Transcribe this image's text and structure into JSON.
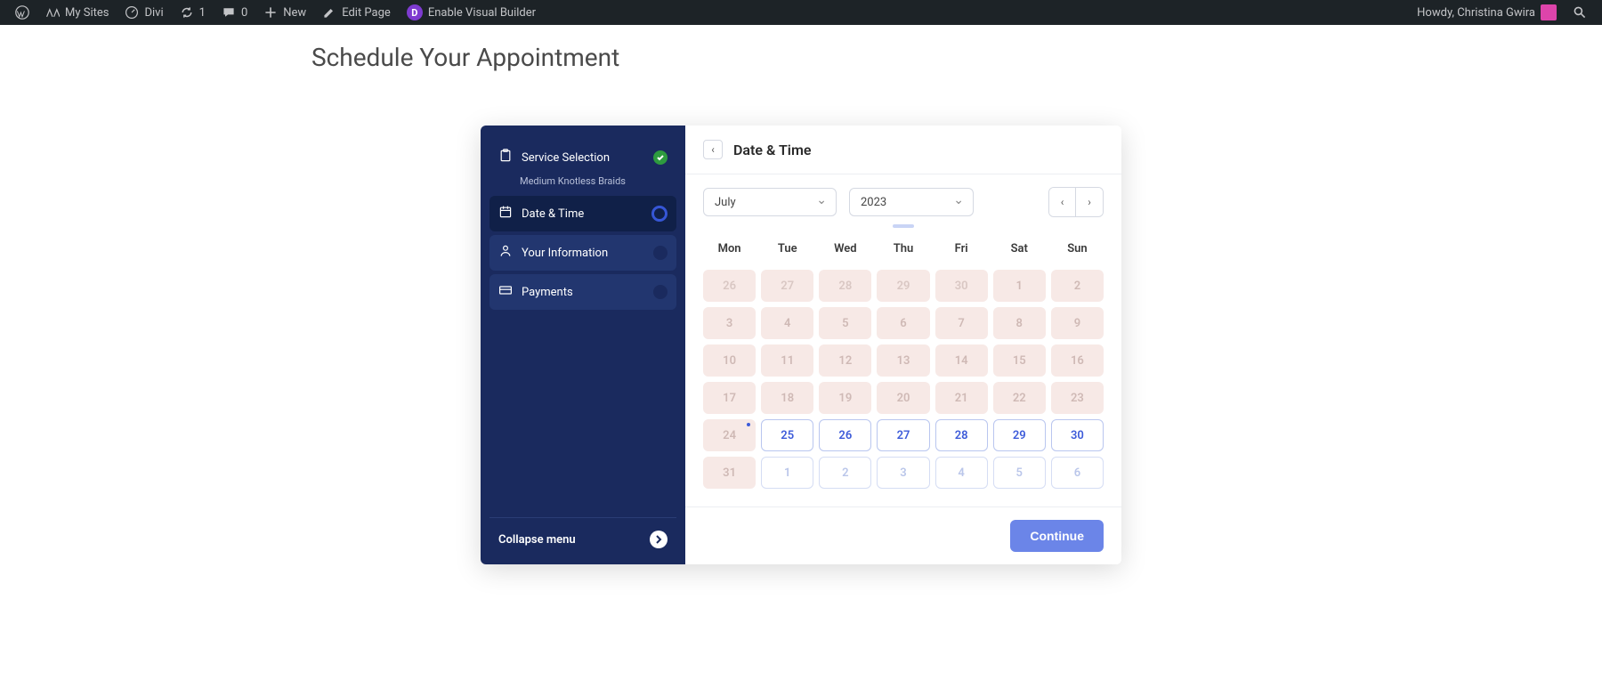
{
  "adminbar": {
    "mysites": "My Sites",
    "divi": "Divi",
    "updates": "1",
    "comments": "0",
    "new": "New",
    "edit_page": "Edit Page",
    "visual_builder": "Enable Visual Builder",
    "howdy": "Howdy, Christina Gwira"
  },
  "page": {
    "title": "Schedule Your Appointment"
  },
  "sidebar": {
    "steps": [
      {
        "label": "Service Selection",
        "sub": "Medium Knotless Braids"
      },
      {
        "label": "Date & Time"
      },
      {
        "label": "Your Information"
      },
      {
        "label": "Payments"
      }
    ],
    "collapse": "Collapse menu"
  },
  "main": {
    "title": "Date & Time",
    "month": "July",
    "year": "2023",
    "weekdays": [
      "Mon",
      "Tue",
      "Wed",
      "Thu",
      "Fri",
      "Sat",
      "Sun"
    ],
    "days": [
      {
        "n": "26",
        "state": "disabled",
        "other": true
      },
      {
        "n": "27",
        "state": "disabled",
        "other": true
      },
      {
        "n": "28",
        "state": "disabled",
        "other": true
      },
      {
        "n": "29",
        "state": "disabled",
        "other": true
      },
      {
        "n": "30",
        "state": "disabled",
        "other": true
      },
      {
        "n": "1",
        "state": "disabled"
      },
      {
        "n": "2",
        "state": "disabled"
      },
      {
        "n": "3",
        "state": "disabled"
      },
      {
        "n": "4",
        "state": "disabled"
      },
      {
        "n": "5",
        "state": "disabled"
      },
      {
        "n": "6",
        "state": "disabled"
      },
      {
        "n": "7",
        "state": "disabled"
      },
      {
        "n": "8",
        "state": "disabled"
      },
      {
        "n": "9",
        "state": "disabled"
      },
      {
        "n": "10",
        "state": "disabled"
      },
      {
        "n": "11",
        "state": "disabled"
      },
      {
        "n": "12",
        "state": "disabled"
      },
      {
        "n": "13",
        "state": "disabled"
      },
      {
        "n": "14",
        "state": "disabled"
      },
      {
        "n": "15",
        "state": "disabled"
      },
      {
        "n": "16",
        "state": "disabled"
      },
      {
        "n": "17",
        "state": "disabled"
      },
      {
        "n": "18",
        "state": "disabled"
      },
      {
        "n": "19",
        "state": "disabled"
      },
      {
        "n": "20",
        "state": "disabled"
      },
      {
        "n": "21",
        "state": "disabled"
      },
      {
        "n": "22",
        "state": "disabled"
      },
      {
        "n": "23",
        "state": "disabled"
      },
      {
        "n": "24",
        "state": "disabled",
        "today": true
      },
      {
        "n": "25",
        "state": "available"
      },
      {
        "n": "26",
        "state": "available"
      },
      {
        "n": "27",
        "state": "available"
      },
      {
        "n": "28",
        "state": "available"
      },
      {
        "n": "29",
        "state": "available"
      },
      {
        "n": "30",
        "state": "available"
      },
      {
        "n": "31",
        "state": "disabled"
      },
      {
        "n": "1",
        "state": "available",
        "other": true
      },
      {
        "n": "2",
        "state": "available",
        "other": true
      },
      {
        "n": "3",
        "state": "available",
        "other": true
      },
      {
        "n": "4",
        "state": "available",
        "other": true
      },
      {
        "n": "5",
        "state": "available",
        "other": true
      },
      {
        "n": "6",
        "state": "available",
        "other": true
      }
    ],
    "continue": "Continue"
  }
}
